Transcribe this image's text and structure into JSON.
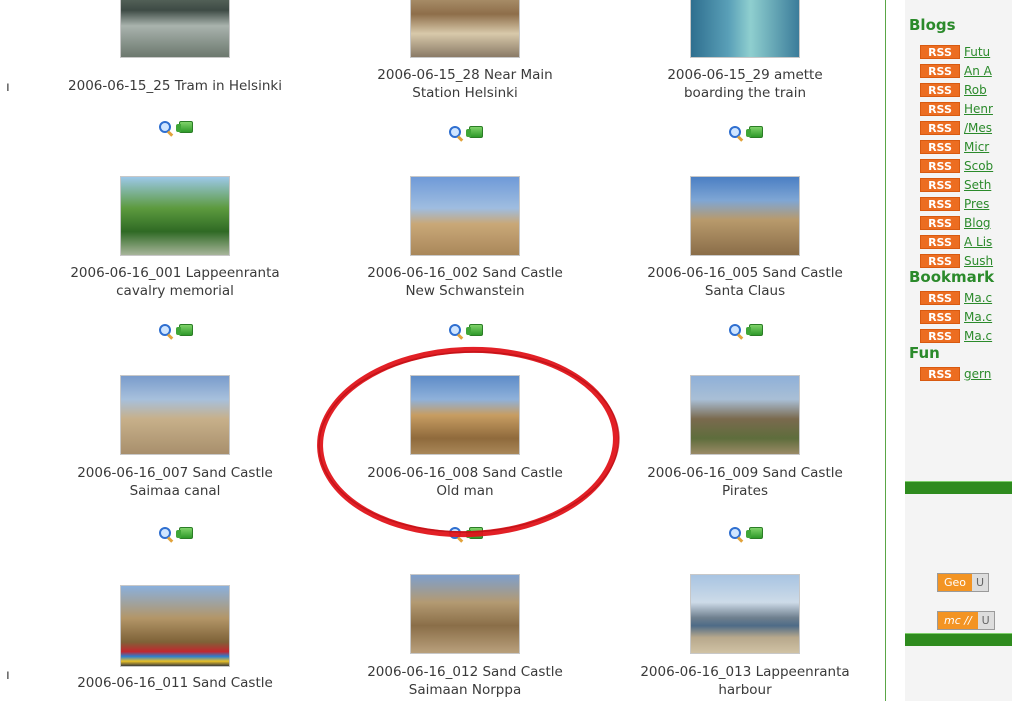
{
  "gallery": {
    "row1": [
      {
        "caption_1": "2006-06-15_25 Tram in Helsinki",
        "caption_2": ""
      },
      {
        "caption_1": "2006-06-15_28 Near Main",
        "caption_2": "Station Helsinki"
      },
      {
        "caption_1": "2006-06-15_29 amette",
        "caption_2": "boarding the train"
      }
    ],
    "row2": [
      {
        "caption_1": "2006-06-16_001 Lappeenranta",
        "caption_2": "cavalry memorial"
      },
      {
        "caption_1": "2006-06-16_002 Sand Castle",
        "caption_2": "New Schwanstein"
      },
      {
        "caption_1": "2006-06-16_005 Sand Castle",
        "caption_2": "Santa Claus"
      }
    ],
    "row3": [
      {
        "caption_1": "2006-06-16_007 Sand Castle",
        "caption_2": "Saimaa canal"
      },
      {
        "caption_1": "2006-06-16_008 Sand Castle",
        "caption_2": "Old man"
      },
      {
        "caption_1": "2006-06-16_009 Sand Castle",
        "caption_2": "Pirates"
      }
    ],
    "row4": [
      {
        "caption_1": "2006-06-16_011 Sand Castle",
        "caption_2": ""
      },
      {
        "caption_1": "2006-06-16_012 Sand Castle",
        "caption_2": "Saimaan Norppa"
      },
      {
        "caption_1": "2006-06-16_013 Lappeenranta",
        "caption_2": "harbour"
      }
    ],
    "edge_chars": [
      "ı",
      "ı"
    ],
    "icons": [
      "magnifier-icon",
      "gallery-icon"
    ]
  },
  "sidebar": {
    "blogs_title": "Blogs",
    "blogs": [
      "Futu",
      "An A",
      "Rob",
      "Henr",
      "/Mes",
      "Micr",
      "Scob",
      "Seth",
      "Pres",
      "Blog",
      "A Lis",
      "Sush"
    ],
    "bookmarks_title": "Bookmark",
    "bookmarks": [
      "Ma.c",
      "Ma.c",
      "Ma.c"
    ],
    "fun_title": "Fun",
    "fun": [
      "gern"
    ],
    "rss_label": "RSS",
    "badges": [
      {
        "left": "Geo",
        "right": "U"
      },
      {
        "left": "mc //",
        "right": "U"
      }
    ]
  },
  "colors": {
    "accent_green": "#2b8a2b",
    "rss_orange": "#ec6d21",
    "highlight_red": "#e0141a"
  }
}
